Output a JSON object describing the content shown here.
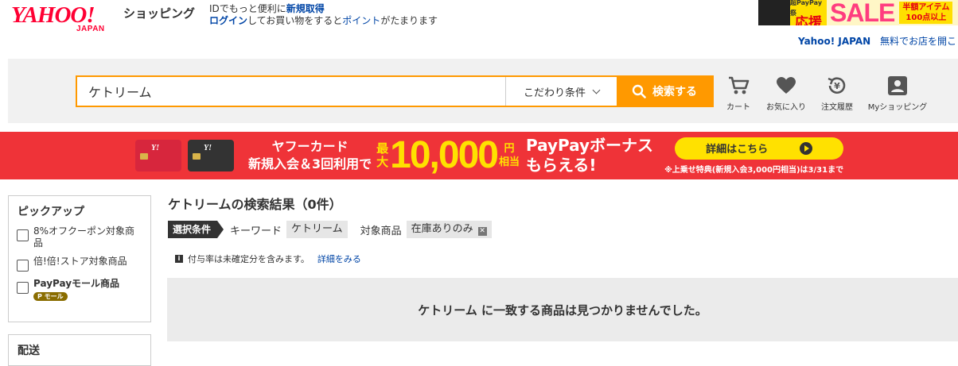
{
  "header": {
    "logo_yahoo": "YAHOO!",
    "logo_japan": "JAPAN",
    "logo_shopping": "ショッピング",
    "promo_line1_pre": "IDでもっと便利に",
    "promo_line1_link": "新規取得",
    "promo_line2_link1": "ログイン",
    "promo_line2_mid": "してお買い物をすると",
    "promo_line2_link2": "ポイント",
    "promo_line2_post": "がたまります",
    "sale_ouen_small": "超PayPay祭",
    "sale_ouen": "応援",
    "sale_word": "SALE",
    "sale_badge_line1": "半額アイテム",
    "sale_badge_line2": "100点以上",
    "top_link_yj": "Yahoo! JAPAN",
    "top_link_free": "無料でお店を開こ"
  },
  "search": {
    "query": "ケトリーム",
    "filter_label": "こだわり条件",
    "button_label": "検索する"
  },
  "nav": {
    "cart": "カート",
    "favorites": "お気に入り",
    "orders": "注文履歴",
    "myshopping": "Myショッピング"
  },
  "banner": {
    "line1": "ヤフーカード",
    "line2": "新規入会＆3回利用で",
    "saidai1": "最",
    "saidai2": "大",
    "amount": "10,000",
    "en1": "円",
    "en2": "相当",
    "paypay1": "PayPayボーナス",
    "paypay2": "もらえる!",
    "detail_button": "詳細はこちら",
    "note": "※上乗せ特典(新規入会3,000円相当)は3/31まで"
  },
  "sidebar": {
    "pickup_title": "ピックアップ",
    "items": [
      {
        "label": "8%オフクーポン対象商品"
      },
      {
        "label": "倍!倍!ストア対象商品"
      },
      {
        "label": "PayPayモール商品",
        "badge": "P モール"
      }
    ],
    "delivery_title": "配送"
  },
  "results": {
    "title": "ケトリームの検索結果（0件）",
    "cond_tag": "選択条件",
    "keyword_key": "キーワード",
    "keyword_value": "ケトリーム",
    "target_key": "対象商品",
    "target_value": "在庫ありのみ",
    "info_text": "付与率は未確定分を含みます。",
    "info_link": "詳細をみる",
    "no_result": "ケトリーム に一致する商品は見つかりませんでした。"
  },
  "colors": {
    "accent_orange": "#ff9900",
    "brand_red": "#ff0033",
    "banner_red": "#ef3338",
    "link_blue": "#0045a6"
  }
}
